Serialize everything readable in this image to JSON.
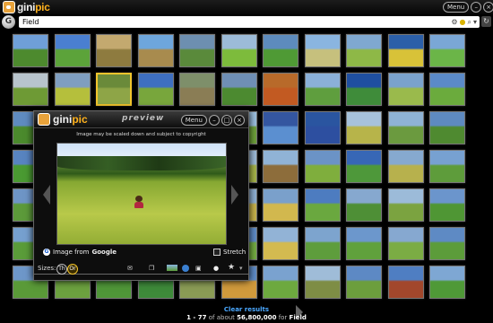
{
  "app": {
    "logo_text_1": "gini",
    "logo_text_2": "pic",
    "menu_label": "Menu",
    "min_glyph": "–",
    "max_glyph": "□",
    "close_glyph": "×"
  },
  "search": {
    "home_glyph": "G",
    "query": "Field",
    "icons": [
      "settings-icon",
      "lightbulb-icon",
      "search-icon",
      "dropdown-icon"
    ],
    "refresh_glyph": "↻"
  },
  "preview": {
    "logo_text_1": "gini",
    "logo_text_2": "pic",
    "title": "preview",
    "menu_label": "Menu",
    "copyright_note": "Image may be scaled down and subject to copyright",
    "source_prefix": "Image from",
    "source_name": "Google",
    "stretch_label": "Stretch"
  },
  "bottom_toolbar": {
    "sizes_label": "Sizes:",
    "size_small": "Th",
    "size_large": "Or"
  },
  "footer": {
    "clear_label": "Clear results",
    "range": "1 - 77",
    "of_about": "of about",
    "total": "56,800,000",
    "for_label": "for",
    "query": "Field"
  },
  "colors": {
    "accent_orange": "#ffb21d",
    "selection": "#f2c42c",
    "link_blue": "#4aa8ff"
  },
  "thumbnails": [
    [
      "#6f9fd8",
      "#4d8a2e"
    ],
    [
      "#4a7fd0",
      "#5ca33a"
    ],
    [
      "#c3a96f",
      "#8e7b3f"
    ],
    [
      "#6ea6dc",
      "#a88b4e"
    ],
    [
      "#6d8fb0",
      "#5a8a3b"
    ],
    [
      "#9cbbd8",
      "#7dbb3c"
    ],
    [
      "#5d8bbd",
      "#4f9a35"
    ],
    [
      "#8ab5e0",
      "#c6c07d"
    ],
    [
      "#7fa8d0",
      "#8eb847"
    ],
    [
      "#2b5fa8",
      "#d8c238"
    ],
    [
      "#7aa7d6",
      "#6bb548"
    ],
    [
      "#b8c4cc",
      "#6e9a35"
    ],
    [
      "#7f9ec0",
      "#b5bf3c"
    ],
    [
      "#6a8a3a",
      "#8ea547"
    ],
    [
      "#3e6fc0",
      "#78a63c"
    ],
    [
      "#7e8f6a",
      "#8a7d55"
    ],
    [
      "#6f8fb5",
      "#4c8a30"
    ],
    [
      "#b86a2a",
      "#c25a22"
    ],
    [
      "#8bb0d8",
      "#5f9e3e"
    ],
    [
      "#1f4fa0",
      "#3f8c3a"
    ],
    [
      "#7aa2cc",
      "#9aba4c"
    ],
    [
      "#5b8ac8",
      "#6bab3d"
    ],
    [
      "#5f8bc0",
      "#4b8a2d"
    ],
    [
      "#6f99cf",
      "#78a83a"
    ],
    [
      "#7ea1c7",
      "#c4b055"
    ],
    [
      "#2a5aa8",
      "#3a7fd0"
    ],
    [
      "#7b9cb8",
      "#8e9d6c"
    ],
    [
      "#9cc0e0",
      "#6ea23b"
    ],
    [
      "#3456a0",
      "#5b8fd0"
    ],
    [
      "#2a55a0",
      "#2d4fa0"
    ],
    [
      "#a7c2db",
      "#b7b44a"
    ],
    [
      "#8fb3d6",
      "#6b9a3f"
    ],
    [
      "#5e8ac0",
      "#4f8a30"
    ],
    [
      "#5884c0",
      "#4a9a32"
    ],
    [
      "#86a7c9",
      "#5b8d34"
    ],
    [
      "#2d5a9e",
      "#e06c30"
    ],
    [
      "#7fa6cf",
      "#62a03a"
    ],
    [
      "#c2b07a",
      "#7a6a3c"
    ],
    [
      "#9dbbd8",
      "#a6b44a"
    ],
    [
      "#90b3d6",
      "#8d6d3b"
    ],
    [
      "#6b93c6",
      "#7fae3d"
    ],
    [
      "#3767b6",
      "#4e983a"
    ],
    [
      "#86a9cf",
      "#b7b14d"
    ],
    [
      "#77a1d1",
      "#5e9c3b"
    ],
    [
      "#6e95c6",
      "#5c9a3a"
    ],
    [
      "#7da3cb",
      "#4f8a31"
    ],
    [
      "#8aa9cc",
      "#6d9a40"
    ],
    [
      "#a9c6e2",
      "#6aa23c"
    ],
    [
      "#5c86c3",
      "#66a23c"
    ],
    [
      "#8fb1d5",
      "#c8b34c"
    ],
    [
      "#7aa0cb",
      "#d2b84e"
    ],
    [
      "#4d7cc0",
      "#6aa83f"
    ],
    [
      "#86a8cf",
      "#4e8f36"
    ],
    [
      "#9cbbd9",
      "#7ba340"
    ],
    [
      "#6b95cc",
      "#4f9634"
    ],
    [
      "#76a0cf",
      "#5a9c39"
    ],
    [
      "#6a95c9",
      "#5fa03b"
    ],
    [
      "#3e6cb4",
      "#5aa340"
    ],
    [
      "#9cb9d6",
      "#7aa641"
    ],
    [
      "#85a8cf",
      "#69a33e"
    ],
    [
      "#5f8cc8",
      "#75ad42"
    ],
    [
      "#92b3d6",
      "#d3ba50"
    ],
    [
      "#7da4ce",
      "#5e9d3c"
    ],
    [
      "#6c97cc",
      "#60a13c"
    ],
    [
      "#86a8d0",
      "#7bac44"
    ],
    [
      "#5e8ac4",
      "#5c9c3a"
    ],
    [
      "#6e97c9",
      "#5a9a38"
    ],
    [
      "#7ca0ca",
      "#6ca13f"
    ],
    [
      "#8aaed4",
      "#4f9638"
    ],
    [
      "#2f62b3",
      "#3e8a3a"
    ],
    [
      "#9bbad8",
      "#8a9b55"
    ],
    [
      "#5f8dc8",
      "#d09a3c"
    ],
    [
      "#7aa2cf",
      "#6da93f"
    ],
    [
      "#9fbcd8",
      "#7e8d45"
    ],
    [
      "#5d89c4",
      "#6c9e3d"
    ],
    [
      "#4f7ec2",
      "#a2472c"
    ],
    [
      "#7ea7d3",
      "#4f9937"
    ]
  ]
}
